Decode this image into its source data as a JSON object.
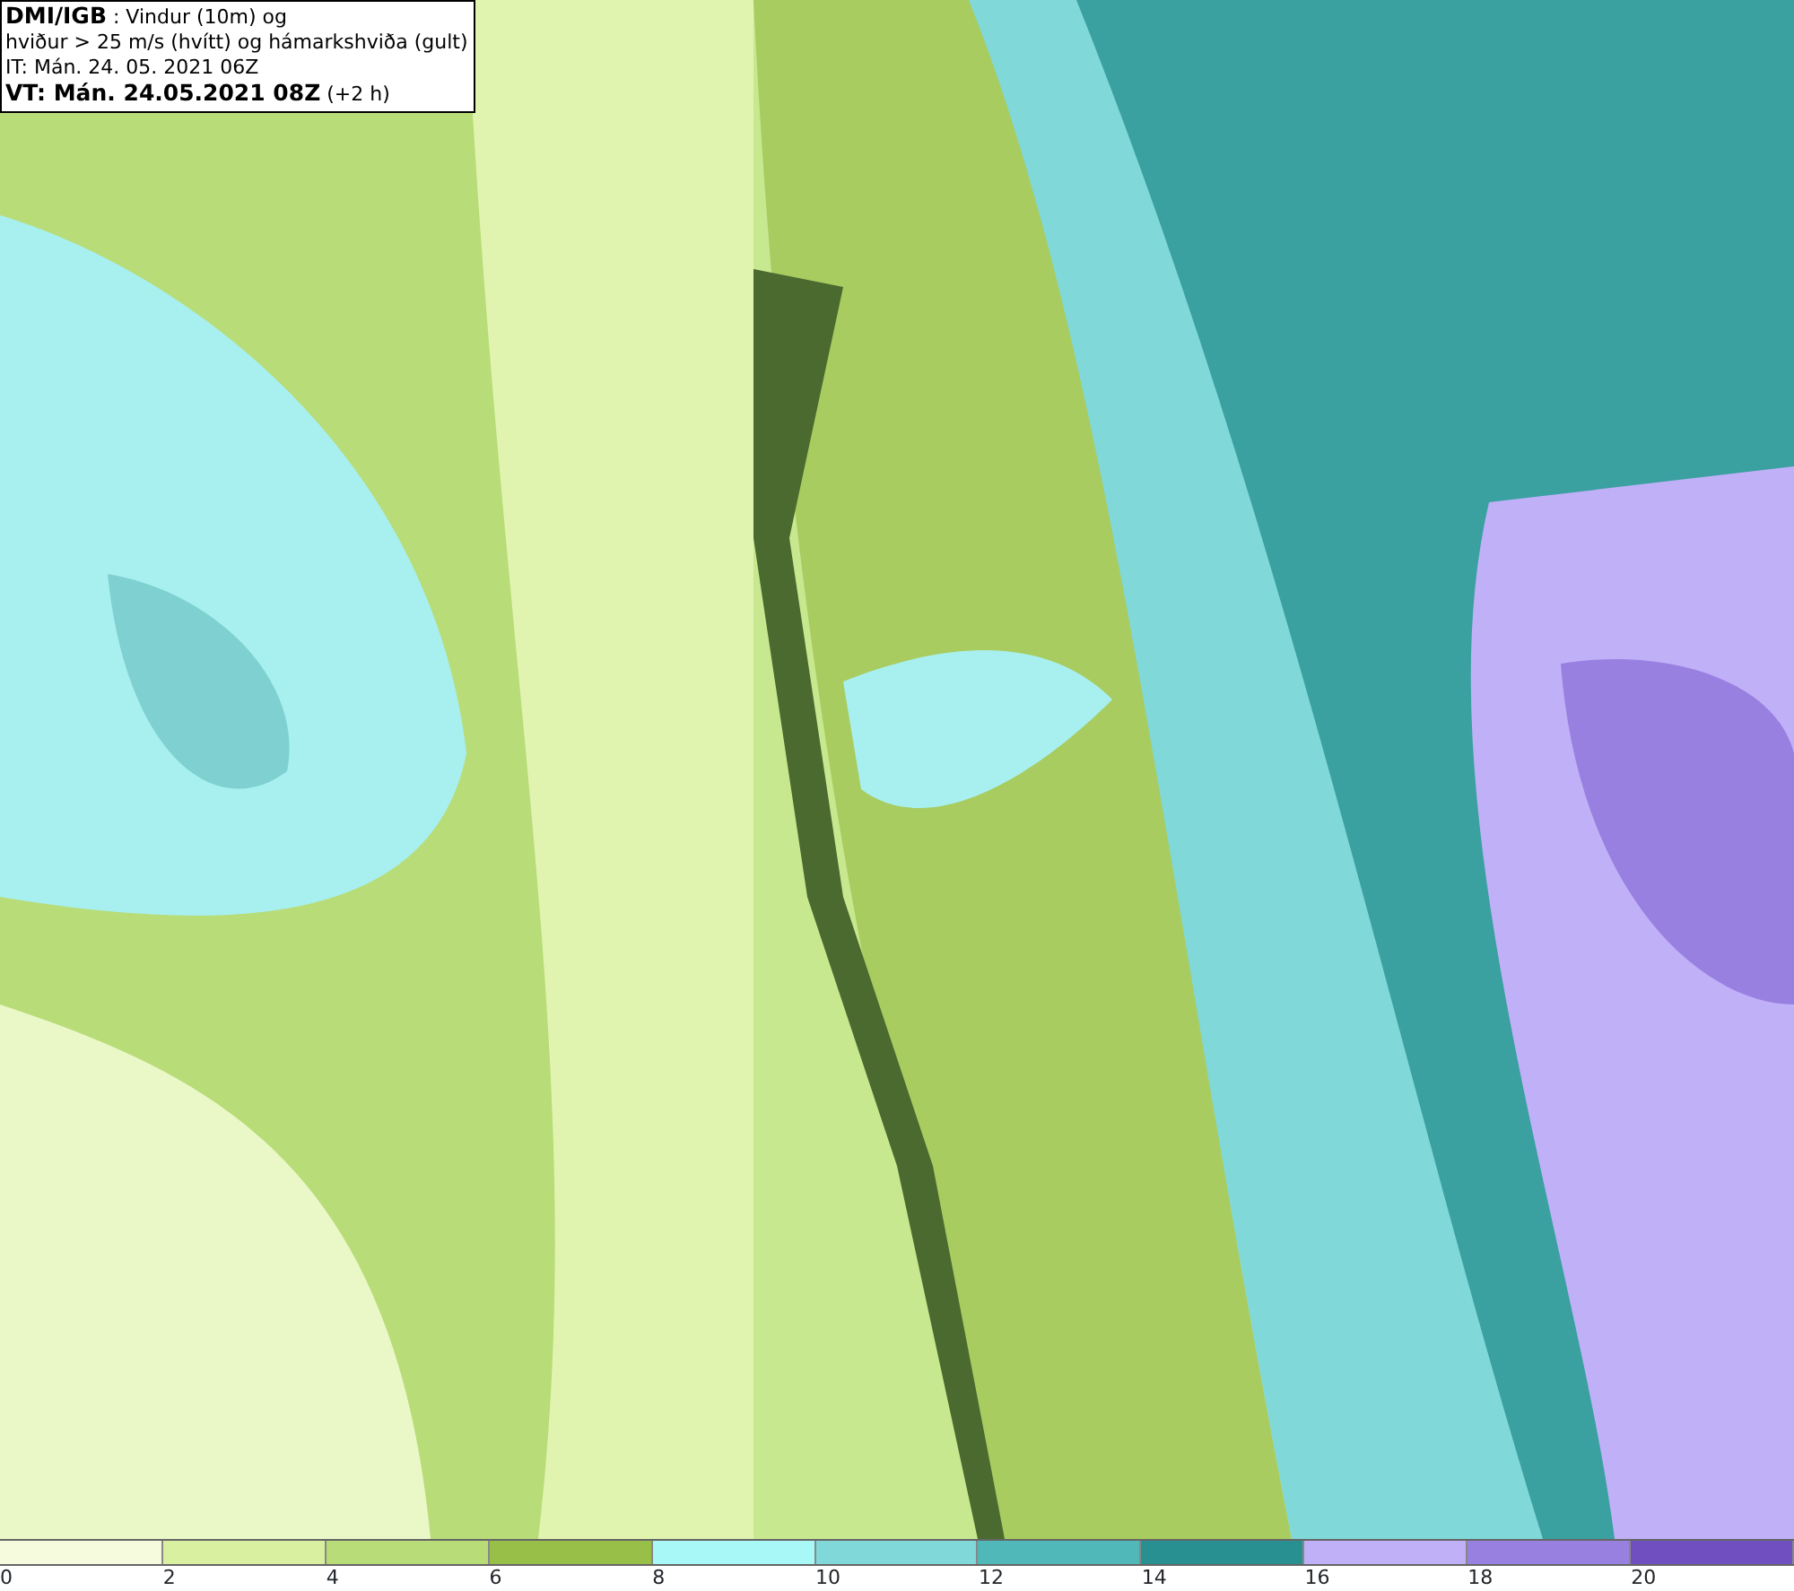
{
  "header": {
    "lines": [
      "**DMI/IGB** : Vindur (10m) og",
      "hviður > 25 m/s (hvítt) og hámarkshviða (gult)",
      "IT: Mán. 24. 05. 2021 06Z",
      "**VT: Mán. 24.05.2021 08Z** (+2 h)"
    ]
  },
  "legend": {
    "segments": [
      {
        "color": "#f5fbdc"
      },
      {
        "color": "#d8f0a0"
      },
      {
        "color": "#b8dc78"
      },
      {
        "color": "#98c048"
      },
      {
        "color": "#a8f8f8"
      },
      {
        "color": "#80d8d8"
      },
      {
        "color": "#50b8b8"
      },
      {
        "color": "#289090"
      },
      {
        "color": "#c0b0f8"
      },
      {
        "color": "#9880e0"
      },
      {
        "color": "#7050c0"
      }
    ],
    "ticks": [
      "0",
      "2",
      "4",
      "6",
      "8",
      "10",
      "12",
      "14",
      "16",
      "18",
      "20"
    ]
  }
}
